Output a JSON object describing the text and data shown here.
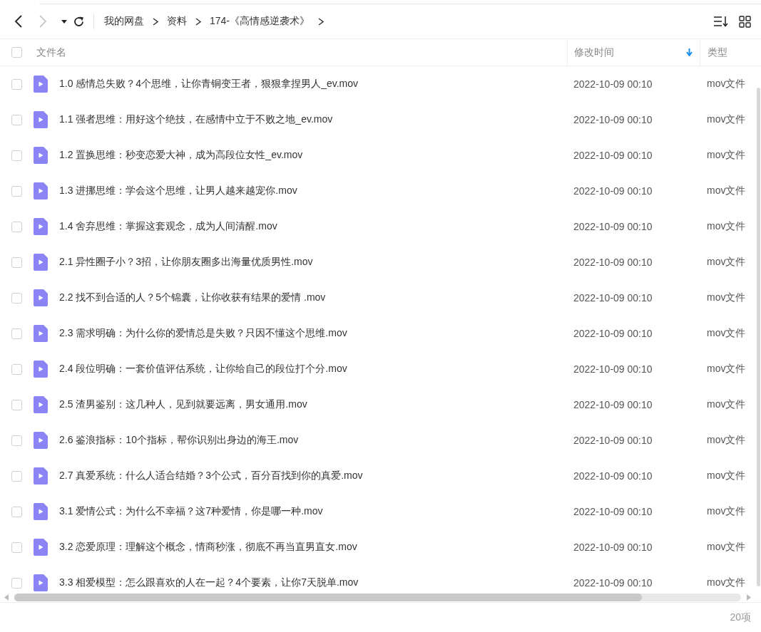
{
  "toolbar": {
    "back_disabled": false,
    "forward_disabled": true
  },
  "breadcrumbs": [
    "我的网盘",
    "资料",
    "174-《高情感逆袭术》"
  ],
  "table": {
    "select_all": {
      "checked": false
    },
    "columns": [
      {
        "label": "文件名",
        "sorted": false
      },
      {
        "label": "修改时间",
        "sorted": true
      },
      {
        "label": "类型",
        "sorted": false
      }
    ],
    "rows": [
      {
        "name": "1.0 感情总失败？4个思维，让你青铜变王者，狠狠拿捏男人_ev.mov",
        "modified": "2022-10-09 00:10",
        "type": "mov文件",
        "checked": false
      },
      {
        "name": "1.1 强者思维：用好这个绝技，在感情中立于不败之地_ev.mov",
        "modified": "2022-10-09 00:10",
        "type": "mov文件",
        "checked": false
      },
      {
        "name": "1.2 置换思维：秒变恋爱大神，成为高段位女性_ev.mov",
        "modified": "2022-10-09 00:10",
        "type": "mov文件",
        "checked": false
      },
      {
        "name": "1.3 进挪思维：学会这个思维，让男人越来越宠你.mov",
        "modified": "2022-10-09 00:10",
        "type": "mov文件",
        "checked": false
      },
      {
        "name": "1.4 舍弃思维：掌握这套观念，成为人间清醒.mov",
        "modified": "2022-10-09 00:10",
        "type": "mov文件",
        "checked": false
      },
      {
        "name": "2.1 异性圈子小？3招，让你朋友圈多出海量优质男性.mov",
        "modified": "2022-10-09 00:10",
        "type": "mov文件",
        "checked": false
      },
      {
        "name": "2.2 找不到合适的人？5个锦囊，让你收获有结果的爱情 .mov",
        "modified": "2022-10-09 00:10",
        "type": "mov文件",
        "checked": false
      },
      {
        "name": "2.3 需求明确：为什么你的爱情总是失败？只因不懂这个思维.mov",
        "modified": "2022-10-09 00:10",
        "type": "mov文件",
        "checked": false
      },
      {
        "name": "2.4 段位明确：一套价值评估系统，让你给自己的段位打个分.mov",
        "modified": "2022-10-09 00:10",
        "type": "mov文件",
        "checked": false
      },
      {
        "name": "2.5 渣男鉴别：这几种人，见到就要远离，男女通用.mov",
        "modified": "2022-10-09 00:10",
        "type": "mov文件",
        "checked": false
      },
      {
        "name": "2.6 鉴浪指标：10个指标，帮你识别出身边的海王.mov",
        "modified": "2022-10-09 00:10",
        "type": "mov文件",
        "checked": false
      },
      {
        "name": "2.7 真爱系统：什么人适合结婚？3个公式，百分百找到你的真爱.mov",
        "modified": "2022-10-09 00:10",
        "type": "mov文件",
        "checked": false
      },
      {
        "name": "3.1 爱情公式：为什么不幸福？这7种爱情，你是哪一种.mov",
        "modified": "2022-10-09 00:10",
        "type": "mov文件",
        "checked": false
      },
      {
        "name": "3.2 恋爱原理：理解这个概念，情商秒涨，彻底不再当直男直女.mov",
        "modified": "2022-10-09 00:10",
        "type": "mov文件",
        "checked": false
      },
      {
        "name": "3.3 相爱模型：怎么跟喜欢的人在一起？4个要素，让你7天脱单.mov",
        "modified": "2022-10-09 00:10",
        "type": "mov文件",
        "checked": false
      }
    ]
  },
  "status_bar": {
    "count": "20项"
  }
}
